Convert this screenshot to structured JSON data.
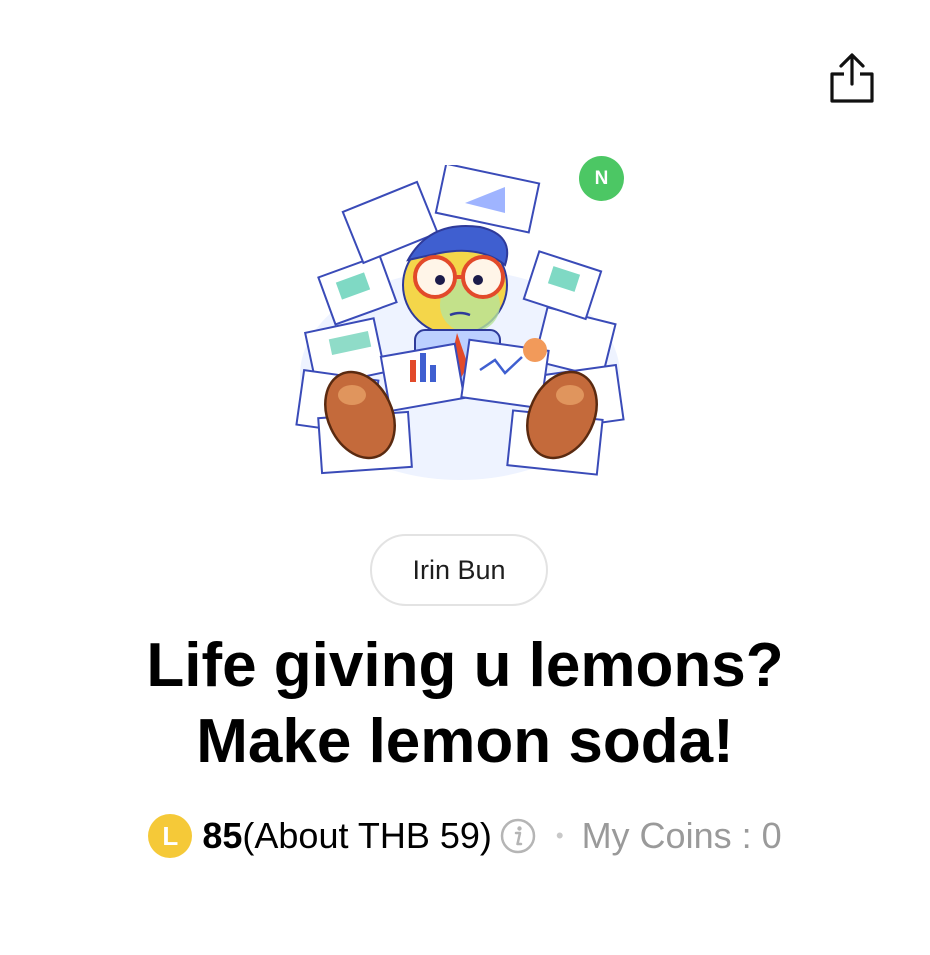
{
  "header": {
    "share_icon": "share-icon"
  },
  "sticker": {
    "new_badge": "N",
    "author": "Irin Bun",
    "title_line1": "Life giving u lemons?",
    "title_line2": "Make lemon soda!"
  },
  "price": {
    "coin_icon": "L",
    "amount": "85",
    "approx": "(About THB 59)",
    "info_icon": "info-icon",
    "separator": "•",
    "my_coins": "My Coins : 0"
  },
  "colors": {
    "badge_green": "#4cc764",
    "coin_yellow": "#f5c938",
    "muted_gray": "#9a9a9a"
  }
}
